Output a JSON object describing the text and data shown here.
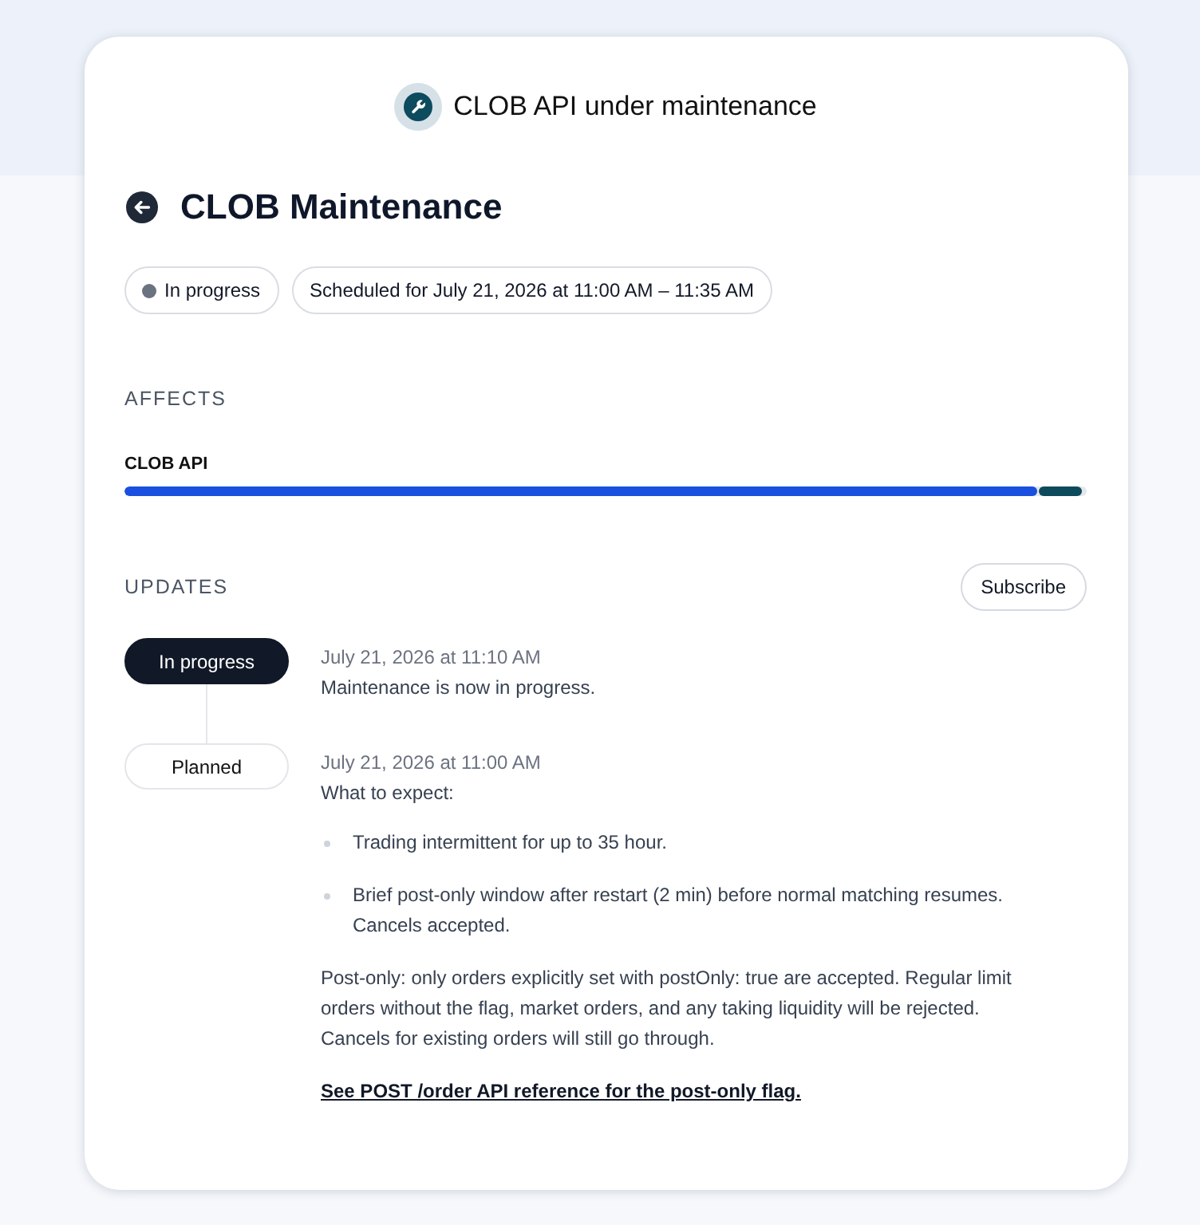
{
  "banner": {
    "title": "CLOB API under maintenance"
  },
  "incident": {
    "title": "CLOB Maintenance",
    "pills": [
      {
        "kind": "status",
        "label": "In progress",
        "color": "#6b7280"
      },
      {
        "kind": "schedule",
        "label": "Scheduled for July 21, 2026 at 11:00 AM – 11:35 AM"
      }
    ]
  },
  "affects": {
    "heading": "AFFECTS",
    "components": [
      {
        "name": "CLOB API",
        "segments": [
          {
            "level": 0.949,
            "color": "#1a4fdf"
          },
          {
            "level": 0.045,
            "color": "#0d4b5c"
          }
        ]
      }
    ]
  },
  "updates": {
    "heading": "UPDATES",
    "subscribe_button": "Subscribe",
    "items": [
      {
        "status": "In progress",
        "current": true,
        "time": "July 21, 2026 at 11:10 AM",
        "blocks": [
          {
            "kind": "text",
            "text": "Maintenance is now in progress."
          }
        ]
      },
      {
        "status": "Planned",
        "current": false,
        "time": "July 21, 2026 at 11:00 AM",
        "blocks": [
          {
            "kind": "text",
            "text": "What to expect:"
          },
          {
            "kind": "bullets",
            "items": [
              "Trading intermittent for up to 35 hour.",
              "Brief post-only window after restart (2 min) before normal matching resumes. Cancels accepted."
            ]
          },
          {
            "kind": "paragraph",
            "text": "Post-only: only orders explicitly set with postOnly: true are accepted. Regular limit orders without the flag, market orders, and any taking liquidity will be rejected. Cancels for existing orders will still go through."
          },
          {
            "kind": "link",
            "text": "See POST /order API reference for the post-only flag."
          }
        ]
      }
    ]
  }
}
